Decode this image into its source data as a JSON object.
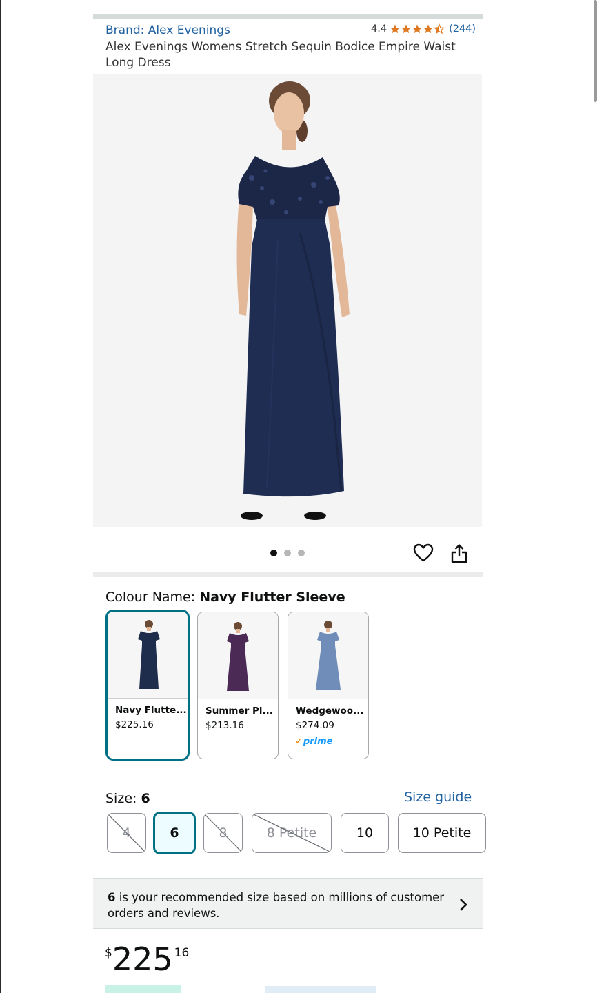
{
  "header": {
    "brand": "Brand: Alex Evenings",
    "rating": "4.4",
    "rating_stars": 4.4,
    "review_count": "(244)",
    "title": "Alex Evenings Womens Stretch Sequin Bodice Empire Waist Long Dress"
  },
  "gallery": {
    "image_count": 3,
    "active_index": 0,
    "main_image": "navy-flutter-sleeve-dress-photo"
  },
  "actions": {
    "wishlist_icon": "heart-icon",
    "share_icon": "share-icon"
  },
  "colour": {
    "label": "Colour Name: ",
    "selected": "Navy Flutter Sleeve",
    "options": [
      {
        "name": "Navy Flutte...",
        "price": "$225.16",
        "prime": "",
        "color": "#1f2d4d",
        "selected": true
      },
      {
        "name": "Summer Pl...",
        "price": "$213.16",
        "prime": "",
        "color": "#4b2a55",
        "selected": false
      },
      {
        "name": "Wedgewoo...",
        "price": "$274.09",
        "prime": "prime",
        "color": "#6f8db8",
        "selected": false
      }
    ]
  },
  "size": {
    "label": "Size: ",
    "selected": "6",
    "guide_label": "Size guide",
    "options": [
      {
        "label": "4",
        "available": false
      },
      {
        "label": "6",
        "available": true,
        "selected": true
      },
      {
        "label": "8",
        "available": false
      },
      {
        "label": "8 Petite",
        "available": false
      },
      {
        "label": "10",
        "available": true
      },
      {
        "label": "10 Petite",
        "available": true
      }
    ]
  },
  "recommendation": {
    "size": "6",
    "text": " is your recommended size based on millions of customer orders and reviews."
  },
  "price": {
    "currency": "$",
    "whole": "225",
    "fraction": "16"
  },
  "colors": {
    "link": "#2162a1",
    "selected_border": "#007185",
    "star": "#de7921",
    "prime": "#1399ff"
  }
}
